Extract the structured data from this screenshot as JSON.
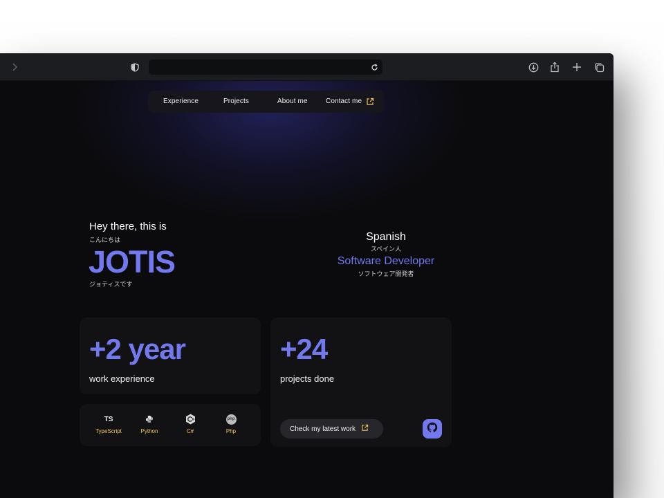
{
  "browser": {
    "url": ""
  },
  "nav": {
    "items": [
      {
        "label": "Experience"
      },
      {
        "label": "Projects"
      },
      {
        "label": "About me"
      },
      {
        "label": "Contact me"
      }
    ]
  },
  "hero": {
    "greeting": "Hey there, this is",
    "greeting_jp": "こんにちは",
    "name": "JOTIS",
    "name_jp": "ジョティスです",
    "nationality": "Spanish",
    "nationality_jp": "スペイン人",
    "role": "Software Developer",
    "role_jp": "ソフトウェア開発者"
  },
  "experience_card": {
    "value": "+2 year",
    "label": "work experience"
  },
  "tech_stack": [
    {
      "label": "TypeScript",
      "icon": "ts-icon",
      "glyph": "TS"
    },
    {
      "label": "Python",
      "icon": "python-icon"
    },
    {
      "label": "C#",
      "icon": "csharp-icon"
    },
    {
      "label": "Php",
      "icon": "php-icon",
      "glyph": "php"
    }
  ],
  "projects_card": {
    "value": "+24",
    "label": "projects done",
    "cta_label": "Check my latest work",
    "github_icon": "github-icon"
  },
  "colors": {
    "accent": "#7279ee",
    "background": "#0b0b0d",
    "card": "#121215",
    "tech_label": "#f3c75e"
  }
}
